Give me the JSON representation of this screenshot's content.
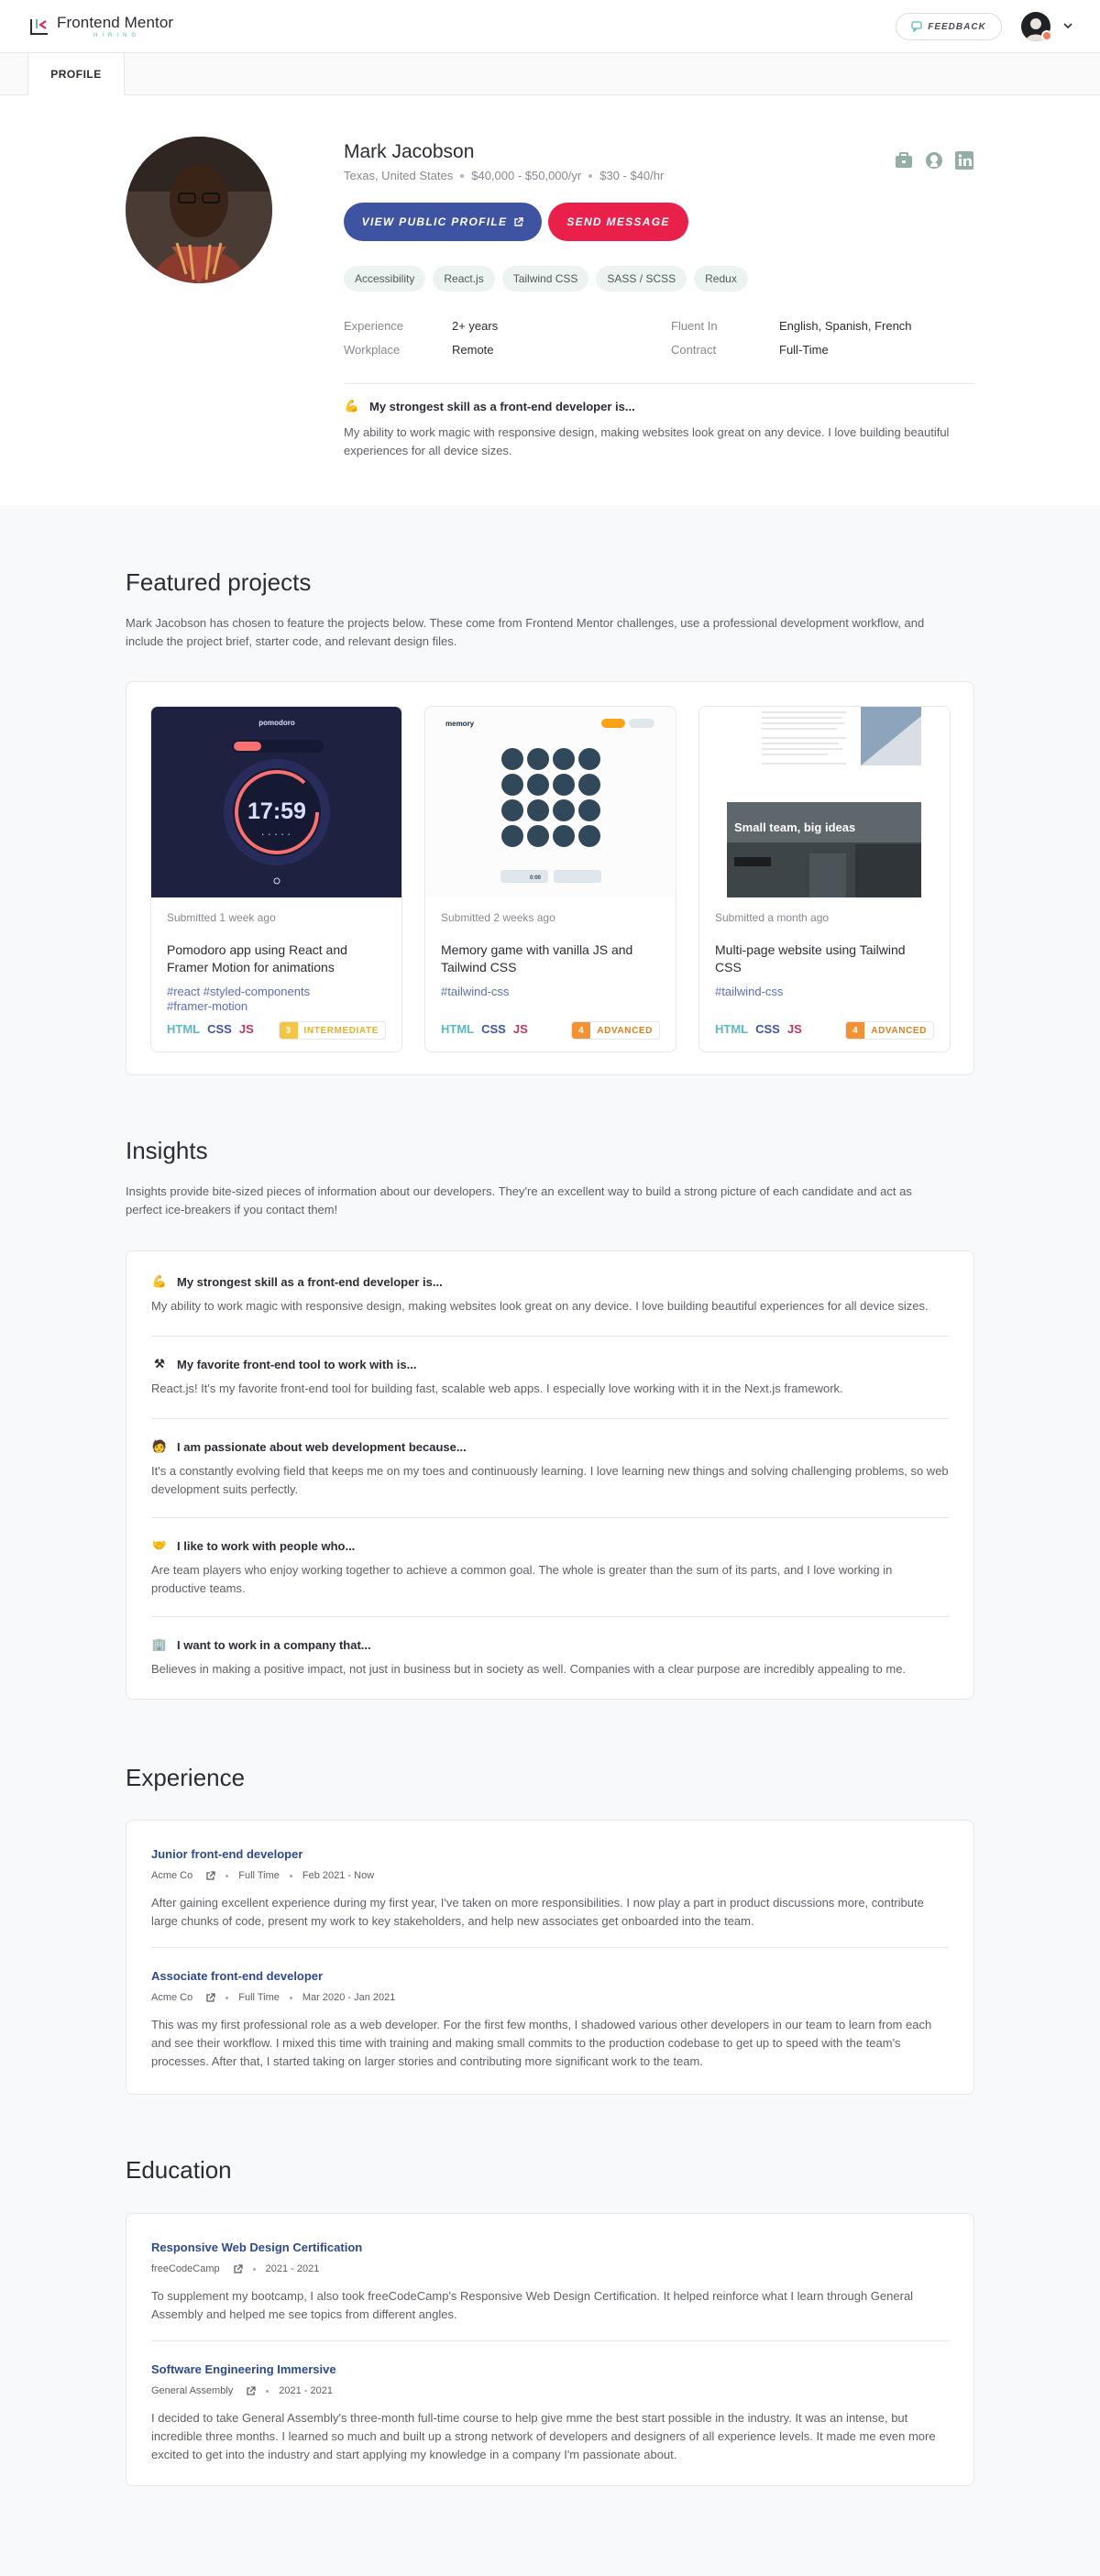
{
  "header": {
    "logo_title": "Frontend Mentor",
    "logo_sub": "HIRING",
    "feedback_label": "FEEDBACK"
  },
  "tabs": [
    {
      "label": "PROFILE"
    }
  ],
  "profile": {
    "name": "Mark Jacobson",
    "location": "Texas, United States",
    "salary": "$40,000 - $50,000/yr",
    "rate": "$30 - $40/hr",
    "view_button": "VIEW PUBLIC PROFILE",
    "message_button": "SEND MESSAGE",
    "skills": [
      "Accessibility",
      "React.js",
      "Tailwind CSS",
      "SASS / SCSS",
      "Redux"
    ],
    "experience_label": "Experience",
    "experience_value": "2+ years",
    "workplace_label": "Workplace",
    "workplace_value": "Remote",
    "fluent_label": "Fluent In",
    "fluent_value": "English, Spanish, French",
    "contract_label": "Contract",
    "contract_value": "Full-Time",
    "strong_question": "My strongest skill as a front-end developer is...",
    "strong_answer": "My ability to work magic with responsive design, making websites look great on any device. I love building beautiful experiences for all device sizes."
  },
  "featured": {
    "title": "Featured projects",
    "description": "Mark Jacobson has chosen to feature the projects below. These come from Frontend Mentor challenges, use a professional development workflow, and include the project brief, starter code, and relevant design files.",
    "projects": [
      {
        "submitted": "Submitted 1 week ago",
        "title": "Pomodoro app using React and Framer Motion for animations",
        "tags": "#react  #styled-components\n#framer-motion",
        "langs": [
          "HTML",
          "CSS",
          "JS"
        ],
        "level_num": "3",
        "level": "INTERMEDIATE",
        "thumb_app": "pomodoro",
        "thumb_time": "17:59",
        "level_color": "#f4c542"
      },
      {
        "submitted": "Submitted 2 weeks ago",
        "title": "Memory game with vanilla JS and Tailwind CSS",
        "tags": "#tailwind-css",
        "langs": [
          "HTML",
          "CSS",
          "JS"
        ],
        "level_num": "4",
        "level": "ADVANCED",
        "thumb_app": "memory",
        "thumb_time": "0:00",
        "level_color": "#f39233"
      },
      {
        "submitted": "Submitted a month ago",
        "title": "Multi-page website using Tailwind CSS",
        "tags": "#tailwind-css",
        "langs": [
          "HTML",
          "CSS",
          "JS"
        ],
        "level_num": "4",
        "level": "ADVANCED",
        "thumb_heading": "Small team, big ideas",
        "level_color": "#f39233"
      }
    ]
  },
  "insights": {
    "title": "Insights",
    "description": "Insights provide bite-sized pieces of information about our developers. They're an excellent way to build a strong picture of each candidate and act as perfect ice-breakers if you contact them!",
    "items": [
      {
        "emoji": "💪",
        "question": "My strongest skill as a front-end developer is...",
        "answer": "My ability to work magic with responsive design, making websites look great on any device. I love building beautiful experiences for all device sizes."
      },
      {
        "emoji": "⚒",
        "question": "My favorite front-end tool to work with is...",
        "answer": "React.js! It's my favorite front-end tool for building fast, scalable web apps. I especially love working with it in the Next.js framework."
      },
      {
        "emoji": "🧑",
        "question": "I am passionate about web development because...",
        "answer": "It's a constantly evolving field that keeps me on my toes and continuously learning. I love learning new things and solving challenging problems, so web development suits perfectly."
      },
      {
        "emoji": "🤝",
        "question": "I like to work with people who...",
        "answer": "Are team players who enjoy working together to achieve a common goal. The whole is greater than the sum of its parts, and I love working in productive teams."
      },
      {
        "emoji": "🏢",
        "question": "I want to work in a company that...",
        "answer": "Believes in making a positive impact, not just in business but in society as well. Companies with a clear purpose are incredibly appealing to me."
      }
    ]
  },
  "experience": {
    "title": "Experience",
    "jobs": [
      {
        "title": "Junior front-end developer",
        "company": "Acme Co",
        "type": "Full Time",
        "dates": "Feb 2021 - Now",
        "description": "After gaining excellent experience during my first year, I've taken on more responsibilities. I now play a part in product discussions more, contribute large chunks of code, present my work to key stakeholders, and help new associates get onboarded into the team."
      },
      {
        "title": "Associate front-end developer",
        "company": "Acme Co",
        "type": "Full Time",
        "dates": "Mar 2020 - Jan 2021",
        "description": "This was my first professional role as a web developer. For the first few months, I shadowed various other developers in our team to learn from each and see their workflow. I mixed this time with training and making small commits to the production codebase to get up to speed with the team's processes. After that, I started taking on larger stories and contributing more significant work to the team."
      }
    ]
  },
  "education": {
    "title": "Education",
    "items": [
      {
        "title": "Responsive Web Design Certification",
        "school": "freeCodeCamp",
        "dates": "2021 - 2021",
        "description": "To supplement my bootcamp, I also took freeCodeCamp's Responsive Web Design Certification. It helped reinforce what I learn through General Assembly and helped me see topics from different angles."
      },
      {
        "title": "Software Engineering Immersive",
        "school": "General Assembly",
        "dates": "2021 - 2021",
        "description": "I decided to take General Assembly's three-month full-time course to help give mme the best start possible in the industry. It was an intense, but incredible three months. I learned so much and built up a strong network of developers and designers of all experience levels. It made me even more excited to get into the industry and start applying my knowledge in a company I'm passionate about."
      }
    ]
  },
  "colors": {
    "primary": "#3e54a3",
    "accent": "#e8204a",
    "html": "#5bb9c1",
    "css": "#3e54a3",
    "js": "#c0385a"
  }
}
